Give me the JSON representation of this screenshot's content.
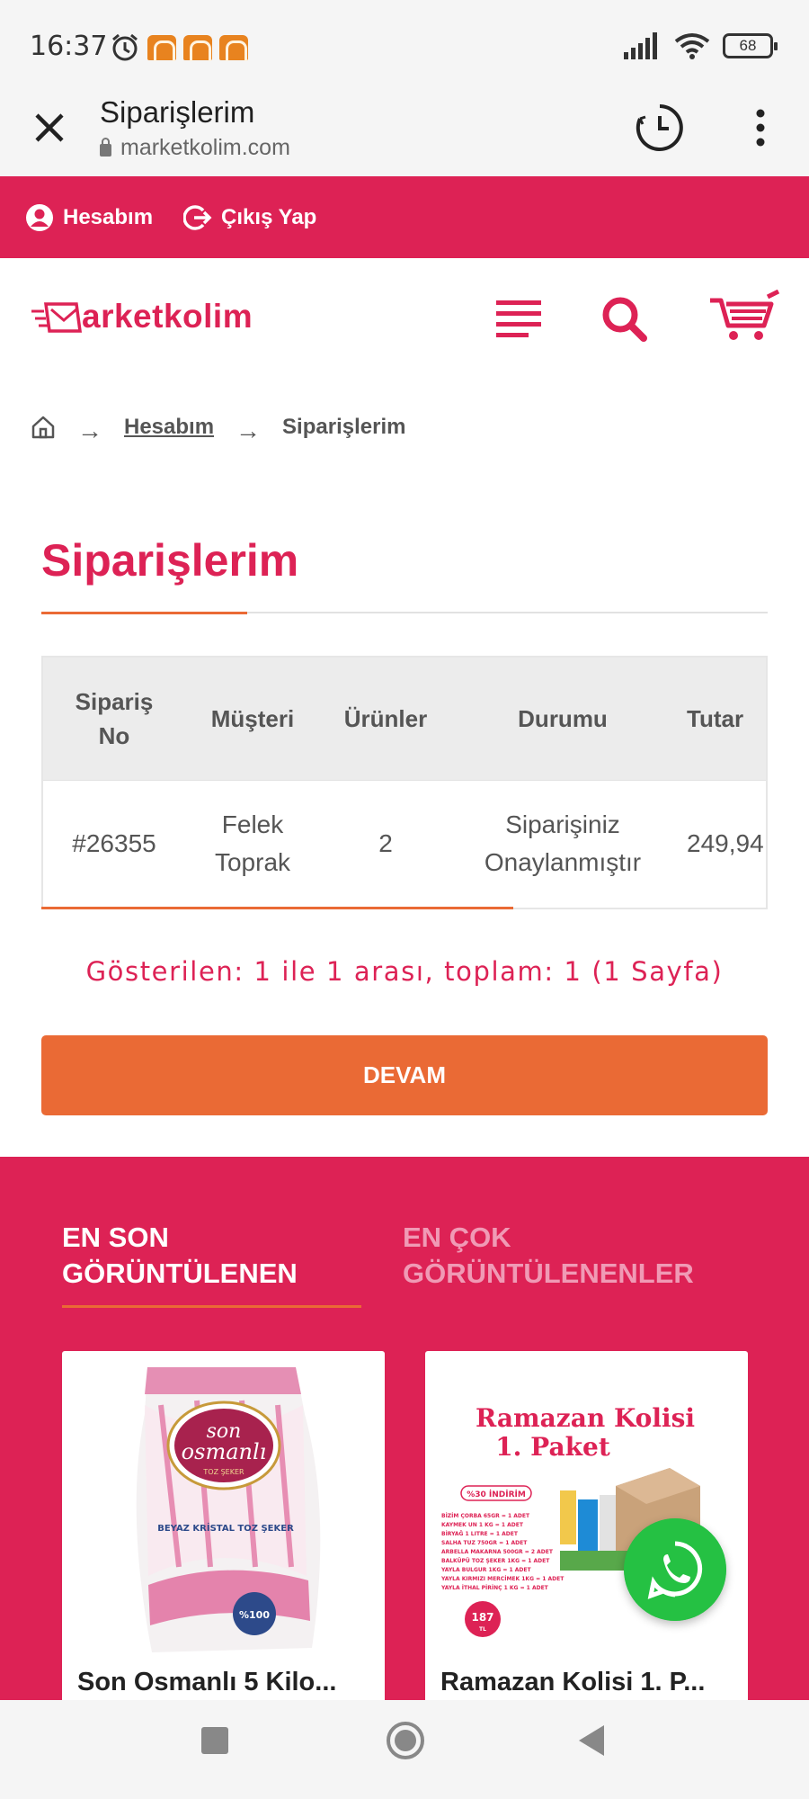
{
  "status_bar": {
    "time": "16:37",
    "battery": "68"
  },
  "browser": {
    "title": "Siparişlerim",
    "url": "marketkolim.com"
  },
  "top_nav": {
    "account": "Hesabım",
    "logout": "Çıkış Yap"
  },
  "brand": {
    "logo_text": "arketkolim",
    "logo_initial": "M",
    "primary_color": "#dd2255",
    "accent_color": "#ea6a35"
  },
  "breadcrumb": {
    "level1": "Hesabım",
    "current": "Siparişlerim",
    "separator": "→"
  },
  "page": {
    "title": "Siparişlerim"
  },
  "orders_table": {
    "headers": {
      "order_no_1": "Sipariş",
      "order_no_2": "No",
      "customer": "Müşteri",
      "products": "Ürünler",
      "status": "Durumu",
      "total": "Tutar"
    },
    "rows": [
      {
        "order_no": "#26355",
        "customer_1": "Felek",
        "customer_2": "Toprak",
        "products": "2",
        "status_1": "Siparişiniz",
        "status_2": "Onaylanmıştır",
        "total": "249,94"
      }
    ]
  },
  "pagination": {
    "summary": "Gösterilen: 1 ile 1 arası, toplam: 1 (1 Sayfa)"
  },
  "continue_button": {
    "label": "DEVAM"
  },
  "recent": {
    "tab_active_1": "EN SON",
    "tab_active_2": "GÖRÜNTÜLENEN",
    "tab_inactive_1": "EN ÇOK",
    "tab_inactive_2": "GÖRÜNTÜLENENLER",
    "products": [
      {
        "name": "Son Osmanlı 5 Kilo...",
        "brand_line1": "son",
        "brand_line2": "osmanlı",
        "brand_sub": "TOZ ŞEKER",
        "label": "BEYAZ KRİSTAL TOZ ŞEKER",
        "badge": "%100"
      },
      {
        "name": "Ramazan Kolisi 1. P...",
        "headline_1": "Ramazan Kolisi",
        "headline_2": "1. Paket",
        "discount": "%30 İNDİRİM",
        "price_badge": "187",
        "price_unit": "TL",
        "contents": [
          "BİZİM ÇORBA 65GR = 1 ADET",
          "KAYMEK UN 1 KG = 1 ADET",
          "BİRYAĞ 1 LITRE = 1 ADET",
          "SALHA TUZ 750GR = 1 ADET",
          "ARBELLA MAKARNA 500GR = 2 ADET",
          "BALKÜPÜ TOZ ŞEKER 1KG = 1 ADET",
          "YAYLA BULGUR 1KG = 1 ADET",
          "YAYLA KIRMIZI MERCİMEK 1KG = 1 ADET",
          "YAYLA İTHAL PİRİNÇ 1 KG = 1 ADET"
        ]
      }
    ]
  }
}
